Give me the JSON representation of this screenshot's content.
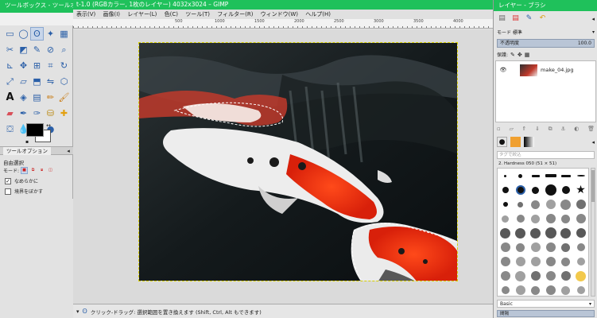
{
  "toolbox_window": {
    "title": "ツールボックス - ツールオ...",
    "tool_options_tab": "ツールオプション",
    "tool_name": "自由選択",
    "mode_label": "モード:",
    "antialias_label": "なめらかに",
    "feather_label": "境界をぼかす",
    "tools": [
      "rect-select",
      "ellipse-select",
      "free-select",
      "fuzzy-select",
      "color-select",
      "scissors",
      "foreground-select",
      "paths",
      "color-picker",
      "zoom",
      "measure",
      "move",
      "align",
      "crop",
      "rotate",
      "scale",
      "shear",
      "perspective",
      "flip",
      "cage",
      "text",
      "bucket-fill",
      "blend",
      "pencil",
      "paintbrush",
      "eraser",
      "airbrush",
      "ink",
      "clone",
      "heal",
      "perspective-clone",
      "blur",
      "smudge",
      "dodge"
    ]
  },
  "image_window": {
    "title": "t-1.0 (RGBカラー, 1枚のレイヤー) 4032x3024 – GIMP",
    "menu": [
      "表示(V)",
      "画像(I)",
      "レイヤー(L)",
      "色(C)",
      "ツール(T)",
      "フィルター(R)",
      "ウィンドウ(W)",
      "ヘルプ(H)"
    ],
    "status_text": "クリック-ドラッグ: 選択範囲を置き換えます (Shift, Ctrl, Alt もできます)",
    "ruler_labels": [
      "500",
      "1000",
      "1500",
      "2000",
      "2500",
      "3000",
      "3500",
      "4000"
    ]
  },
  "layers_window": {
    "title": "レイヤー - ブラシ",
    "mode_label": "モード 標準",
    "opacity_label": "不透明度",
    "opacity_value": "100.0",
    "lock_label": "保護:",
    "layer_name": "make_04.jpg",
    "brush_filter_placeholder": "タグで絞込",
    "brush_name": "2. Hardness 050 (51 × 51)",
    "brush_preset": "Basic",
    "bottom_label": "間隔"
  },
  "colors": {
    "titlebar_green": "#1fc15b",
    "selection": "#3b6cb8"
  }
}
